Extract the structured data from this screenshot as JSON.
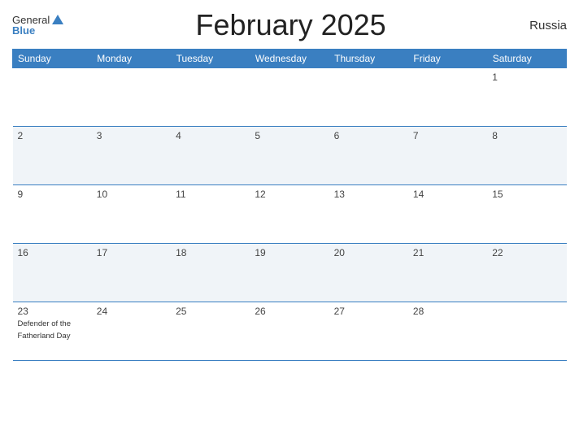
{
  "header": {
    "logo_general": "General",
    "logo_blue": "Blue",
    "title": "February 2025",
    "country": "Russia"
  },
  "weekdays": [
    "Sunday",
    "Monday",
    "Tuesday",
    "Wednesday",
    "Thursday",
    "Friday",
    "Saturday"
  ],
  "weeks": [
    [
      {
        "day": "",
        "holiday": "",
        "empty": true
      },
      {
        "day": "",
        "holiday": "",
        "empty": true
      },
      {
        "day": "",
        "holiday": "",
        "empty": true
      },
      {
        "day": "",
        "holiday": "",
        "empty": true
      },
      {
        "day": "",
        "holiday": "",
        "empty": true
      },
      {
        "day": "",
        "holiday": "",
        "empty": true
      },
      {
        "day": "1",
        "holiday": ""
      }
    ],
    [
      {
        "day": "2",
        "holiday": ""
      },
      {
        "day": "3",
        "holiday": ""
      },
      {
        "day": "4",
        "holiday": ""
      },
      {
        "day": "5",
        "holiday": ""
      },
      {
        "day": "6",
        "holiday": ""
      },
      {
        "day": "7",
        "holiday": ""
      },
      {
        "day": "8",
        "holiday": ""
      }
    ],
    [
      {
        "day": "9",
        "holiday": ""
      },
      {
        "day": "10",
        "holiday": ""
      },
      {
        "day": "11",
        "holiday": ""
      },
      {
        "day": "12",
        "holiday": ""
      },
      {
        "day": "13",
        "holiday": ""
      },
      {
        "day": "14",
        "holiday": ""
      },
      {
        "day": "15",
        "holiday": ""
      }
    ],
    [
      {
        "day": "16",
        "holiday": ""
      },
      {
        "day": "17",
        "holiday": ""
      },
      {
        "day": "18",
        "holiday": ""
      },
      {
        "day": "19",
        "holiday": ""
      },
      {
        "day": "20",
        "holiday": ""
      },
      {
        "day": "21",
        "holiday": ""
      },
      {
        "day": "22",
        "holiday": ""
      }
    ],
    [
      {
        "day": "23",
        "holiday": "Defender of the Fatherland Day"
      },
      {
        "day": "24",
        "holiday": ""
      },
      {
        "day": "25",
        "holiday": ""
      },
      {
        "day": "26",
        "holiday": ""
      },
      {
        "day": "27",
        "holiday": ""
      },
      {
        "day": "28",
        "holiday": ""
      },
      {
        "day": "",
        "holiday": "",
        "empty": true
      }
    ]
  ],
  "row_classes": [
    "row-light",
    "row-dark",
    "row-light",
    "row-dark",
    "row-light"
  ]
}
